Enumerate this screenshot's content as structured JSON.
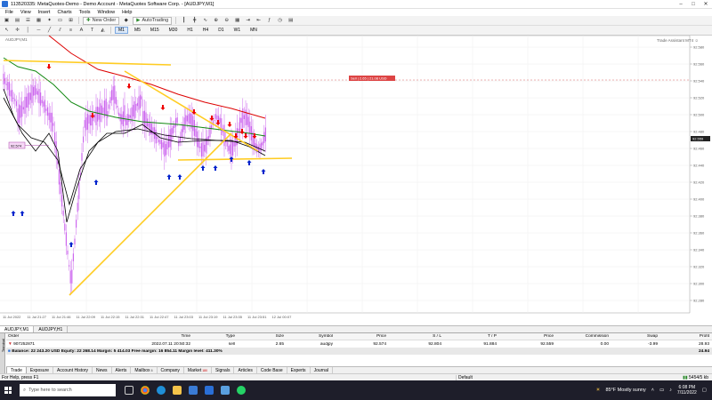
{
  "window": {
    "title": "113520335: MetaQuotes-Demo - Demo Account - MetaQuotes Software Corp. - [AUDJPY,M1]"
  },
  "menu": [
    "File",
    "View",
    "Insert",
    "Charts",
    "Tools",
    "Window",
    "Help"
  ],
  "toolbar": {
    "new_order": "New Order",
    "auto_trading": "AutoTrading"
  },
  "timeframes": [
    "M1",
    "M5",
    "M15",
    "M30",
    "H1",
    "H4",
    "D1",
    "W1",
    "MN"
  ],
  "chart": {
    "symbol_label": "AUDJPY,M1",
    "ea_label": "Trade Assistant MT4 ☺",
    "sell_label": "Sell | 2.65 | 21.08 USD",
    "entry_label": "92.574",
    "price_ticks": [
      "92.580",
      "92.560",
      "92.540",
      "92.520",
      "92.500",
      "92.480",
      "92.460",
      "92.440",
      "92.420",
      "92.400",
      "92.380",
      "92.360",
      "92.340",
      "92.320",
      "92.300",
      "92.280"
    ],
    "bid_label": "92.559",
    "time_ticks": [
      "11 Jul 2022",
      "11 Jul 21:27",
      "11 Jul 21:46",
      "11 Jul 22:09",
      "11 Jul 22:15",
      "11 Jul 22:31",
      "11 Jul 22:47",
      "11 Jul 23:03",
      "11 Jul 23:19",
      "11 Jul 23:35",
      "11 Jul 23:51",
      "12 Jul 00:07"
    ]
  },
  "chart_tabs": [
    "AUDJPY,M1",
    "AUDJPY,H1"
  ],
  "terminal": {
    "headers": {
      "order": "Order",
      "time": "Time",
      "type": "Type",
      "size": "Size",
      "symbol": "Symbol",
      "price": "Price",
      "sl": "S / L",
      "tp": "T / P",
      "price2": "Price",
      "commission": "Commission",
      "swap": "Swap",
      "profit": "Profit"
    },
    "row": {
      "order": "907252871",
      "time": "2022.07.11 20:50:32",
      "type": "sell",
      "size": "2.65",
      "symbol": "audjpy",
      "price": "92.574",
      "sl": "92.804",
      "tp": "91.884",
      "price2": "92.559",
      "commission": "0.00",
      "swap": "-3.99",
      "profit": "28.93"
    },
    "summary": "Balance: 22 243.20 USD  Equity: 22 268.14  Margin: 5 414.03  Free margin: 16 854.11  Margin level: 411.30%",
    "summary_profit": "24.94",
    "tabs": [
      {
        "label": "Trade",
        "badge": ""
      },
      {
        "label": "Exposure",
        "badge": ""
      },
      {
        "label": "Account History",
        "badge": ""
      },
      {
        "label": "News",
        "badge": ""
      },
      {
        "label": "Alerts",
        "badge": ""
      },
      {
        "label": "Mailbox",
        "badge": "6"
      },
      {
        "label": "Company",
        "badge": ""
      },
      {
        "label": "Market",
        "badge": "180"
      },
      {
        "label": "Signals",
        "badge": ""
      },
      {
        "label": "Articles",
        "badge": ""
      },
      {
        "label": "Code Base",
        "badge": ""
      },
      {
        "label": "Experts",
        "badge": ""
      },
      {
        "label": "Journal",
        "badge": ""
      }
    ],
    "side_label": "Terminal"
  },
  "status": {
    "help": "For Help, press F1",
    "profile": "Default",
    "traffic": "5454/5 kb"
  },
  "taskbar": {
    "search_placeholder": "Type here to search",
    "weather": "85°F  Mostly sunny",
    "time": "6:08 PM",
    "date": "7/11/2022"
  },
  "colors": {
    "candles": "#cc66ee",
    "ma_red": "#dd0000",
    "ma_green": "#118811",
    "ma_black": "#000000",
    "trendline": "#ffcc22",
    "arrow_up": "#0022cc",
    "arrow_down": "#ee0000"
  }
}
